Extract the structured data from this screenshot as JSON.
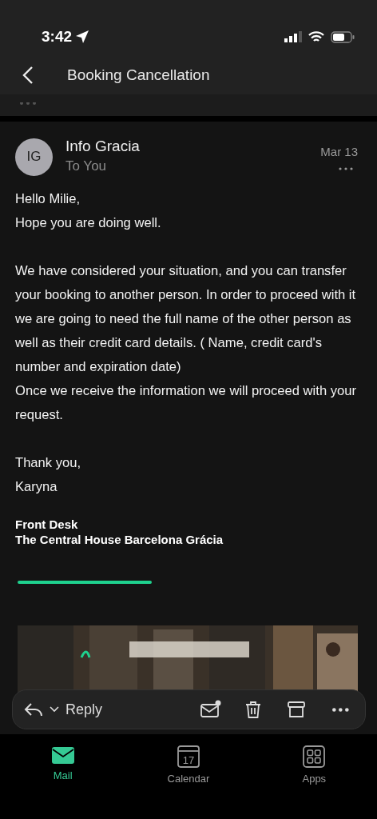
{
  "status_bar": {
    "time": "3:42"
  },
  "header": {
    "title": "Booking Cancellation"
  },
  "message": {
    "avatar": "IG",
    "sender": "Info Gracia",
    "recipient": "To You",
    "date": "Mar 13",
    "body": [
      {
        "lines": [
          "Hello Milie,",
          "Hope you are doing well."
        ]
      },
      {
        "lines": [
          "We have considered your situation, and you can transfer your booking to another person. In order to proceed with it we are going to need the full name of the other person as well as their credit card details. ( Name, credit card's number and expiration date)",
          "Once we receive the information we will proceed with your request."
        ]
      },
      {
        "lines": [
          "Thank you,",
          "Karyna"
        ]
      }
    ],
    "signature": [
      "Front Desk",
      "The Central House Barcelona Grácia"
    ],
    "banner": {
      "kind": "picture"
    }
  },
  "action_bar": {
    "reply": "Reply",
    "actions": [
      {
        "kind": "unread"
      },
      {
        "kind": "delete"
      },
      {
        "kind": "archive"
      },
      {
        "kind": "more"
      }
    ]
  },
  "tabs": [
    {
      "label": "Mail",
      "kind": "mail",
      "selected": true
    },
    {
      "label": "Calendar",
      "kind": "calendar",
      "icon_text": "17",
      "selected": false
    },
    {
      "label": "Apps",
      "kind": "apps",
      "selected": false
    }
  ]
}
